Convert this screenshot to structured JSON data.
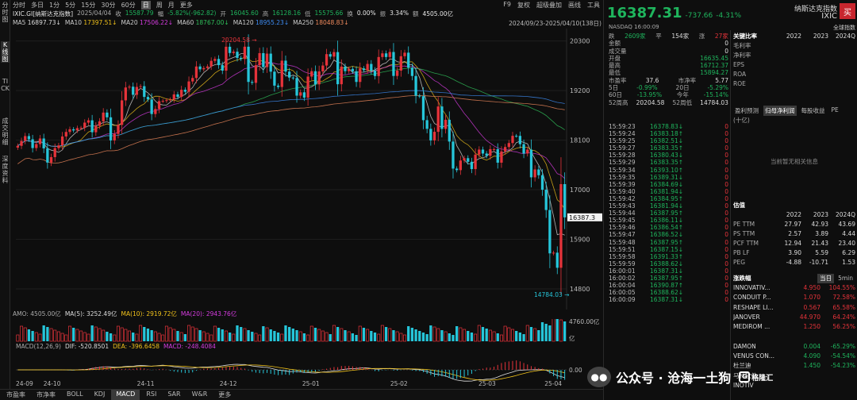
{
  "left_tabs": [
    "分时图",
    "K线图",
    "TICK",
    "成交明细",
    "深度资料"
  ],
  "toolbar": {
    "periods": [
      "分时",
      "多日",
      "1分",
      "5分",
      "15分",
      "30分",
      "60分",
      "日",
      "周",
      "月",
      "更多"
    ],
    "active": "日",
    "right": [
      "F9",
      "复权",
      "超级叠加",
      "画线",
      "工具"
    ]
  },
  "quote_line": {
    "code": "IXIC.GI[纳斯达克指数]",
    "date": "2025/04/04",
    "close_label": "收",
    "close": "15587.79",
    "change_label": "幅",
    "change": "-5.82%(-962.82)",
    "open_label": "开",
    "open": "16045.60",
    "high_label": "高",
    "high": "16128.16",
    "low_label": "低",
    "low": "15575.66",
    "turnover_label": "换",
    "turnover": "0.00%",
    "amp_label": "振",
    "amp": "3.34%",
    "amt_label": "额",
    "amt": "4505.00亿"
  },
  "ma_legend": [
    {
      "label": "MA5",
      "value": "16897.73↓",
      "color": "#dddddd"
    },
    {
      "label": "MA10",
      "value": "17397.51↓",
      "color": "#f1c21b"
    },
    {
      "label": "MA20",
      "value": "17506.22↓",
      "color": "#d63be0"
    },
    {
      "label": "MA60",
      "value": "18767.00↓",
      "color": "#2fbf5a"
    },
    {
      "label": "MA120",
      "value": "18955.23↓",
      "color": "#3e8ef7"
    },
    {
      "label": "MA250",
      "value": "18048.83↓",
      "color": "#f08a5d"
    }
  ],
  "range": "2024/09/23-2025/04/10(138日)",
  "chart_data": {
    "type": "candlestick",
    "ylim": [
      14500,
      20400
    ],
    "y_ticks": [
      "20300",
      "19200",
      "18100",
      "17000",
      "15900",
      "14800"
    ],
    "x_ticks": [
      "24-09",
      "24-10",
      "24-11",
      "24-12",
      "25-01",
      "25-02",
      "25-03",
      "25-04"
    ],
    "max_label": "20204.58",
    "min_label": "14784.03",
    "last_label": "16387.3",
    "close": [
      17974,
      18082,
      18190,
      18119,
      17925,
      18013,
      18137,
      17918,
      17602,
      17724,
      17923,
      17983,
      18182,
      18282,
      18342,
      18315,
      18367,
      18374,
      18489,
      18540,
      18276,
      18417,
      18518,
      18712,
      18607,
      18095,
      18239,
      18439,
      18983,
      19269,
      19286,
      19107,
      19281,
      19298,
      19060,
      19004,
      18680,
      18791,
      18966,
      18972,
      18987,
      19003,
      19116,
      19060,
      19218,
      19174,
      19403,
      19480,
      19735,
      19672,
      19700,
      19736,
      19860,
      19902,
      19765,
      19643,
      20173,
      20034,
      20062,
      19926,
      19902,
      20174,
      19392,
      19372,
      19764,
      20031,
      19722,
      20020,
      19620,
      19310,
      19280,
      19864,
      19621,
      19489,
      19478,
      19088,
      19162,
      19044,
      19511,
      19630,
      19338,
      19626,
      19756,
      20009,
      19954,
      20054,
      19341,
      19733,
      19632,
      19681,
      19628,
      19392,
      19692,
      19654,
      19791,
      19643,
      19523,
      19945,
      20026,
      19945,
      20056,
      19525,
      19644,
      19963,
      20041,
      19709,
      19524,
      19087,
      19076,
      18544,
      18351,
      18095,
      18285,
      18847,
      18350,
      18552,
      18069,
      17469,
      17435,
      17649,
      17700,
      17620,
      17458,
      17780,
      17891,
      17803,
      17752,
      17900,
      17900,
      17600,
      17850,
      17948,
      18036,
      18196,
      18195,
      18011,
      17804,
      17890,
      17275,
      17450,
      17322,
      17000,
      16550,
      15587.79,
      15603,
      15268,
      17124,
      16387.31
    ],
    "annotations": [
      {
        "text": "20204.58",
        "x_index": 62
      },
      {
        "text": "14784.03",
        "x_index": 146
      }
    ]
  },
  "amo_legend": [
    {
      "label": "AMO: 4505.00亿",
      "color": "#aaaaaa"
    },
    {
      "label": "MA(5): 3252.49亿",
      "color": "#dddddd"
    },
    {
      "label": "MA(10): 2919.72亿",
      "color": "#f1c21b"
    },
    {
      "label": "MA(20): 2943.76亿",
      "color": "#d63be0"
    }
  ],
  "amo_axis": [
    "4760.00亿",
    "亿"
  ],
  "macd_legend": [
    {
      "label": "MACD(12,26,9)",
      "color": "#aaaaaa"
    },
    {
      "label": "DIF: -520.8501",
      "color": "#dddddd"
    },
    {
      "label": "DEA: -396.6458",
      "color": "#f1c21b"
    },
    {
      "label": "MACD: -248.4084",
      "color": "#d63be0"
    }
  ],
  "macd_axis": [
    "0.00"
  ],
  "bottom_tabs": [
    "市盈率",
    "市净率",
    "BOLL",
    "KDJ",
    "MACD",
    "RSI",
    "SAR",
    "W&R",
    "更多"
  ],
  "bottom_active": "MACD",
  "header": {
    "price": "16387.31",
    "change": "-737.66",
    "change_pct": "-4.31%",
    "name": "纳斯达克指数",
    "code": "IXIC",
    "buy": "买",
    "exchange": "NASDAQ",
    "time": "16:00:09",
    "settle": "全球指数"
  },
  "breadth": {
    "down_label": "跌",
    "down": "2609家",
    "flat_label": "平",
    "flat": "154家",
    "up_label": "涨",
    "up": "27家"
  },
  "stats": [
    {
      "k": "金额",
      "v": "0",
      "c": "#dddddd"
    },
    {
      "k": "成交量",
      "v": "0",
      "c": "#dddddd"
    },
    {
      "k": "开盘",
      "v": "16635.45",
      "c": "#1fb55d"
    },
    {
      "k": "最高",
      "v": "16712.37",
      "c": "#1fb55d"
    },
    {
      "k": "最低",
      "v": "15894.27",
      "c": "#1fb55d"
    }
  ],
  "stats2": [
    [
      "市盈率",
      "37.6",
      "市净率",
      "5.77"
    ],
    [
      "5日",
      "-0.99%",
      "20日",
      "-5.29%"
    ],
    [
      "60日",
      "-13.95%",
      "今年",
      "-15.14%"
    ],
    [
      "52周高",
      "20204.58",
      "52周低",
      "14784.03"
    ]
  ],
  "ticks": [
    [
      "15:59:23",
      "16378.83↓",
      "0"
    ],
    [
      "15:59:24",
      "16383.18↑",
      "0"
    ],
    [
      "15:59:25",
      "16382.51↓",
      "0"
    ],
    [
      "15:59:27",
      "16383.35↑",
      "0"
    ],
    [
      "15:59:28",
      "16380.43↓",
      "0"
    ],
    [
      "15:59:29",
      "16383.35↑",
      "0"
    ],
    [
      "15:59:34",
      "16393.10↑",
      "0"
    ],
    [
      "15:59:35",
      "16389.31↓",
      "0"
    ],
    [
      "15:59:39",
      "16384.69↓",
      "0"
    ],
    [
      "15:59:40",
      "16381.94↓",
      "0"
    ],
    [
      "15:59:42",
      "16384.95↑",
      "0"
    ],
    [
      "15:59:43",
      "16381.94↓",
      "0"
    ],
    [
      "15:59:44",
      "16387.95↑",
      "0"
    ],
    [
      "15:59:45",
      "16386.11↓",
      "0"
    ],
    [
      "15:59:46",
      "16386.54↑",
      "0"
    ],
    [
      "15:59:47",
      "16386.52↓",
      "0"
    ],
    [
      "15:59:48",
      "16387.95↑",
      "0"
    ],
    [
      "15:59:51",
      "16387.15↓",
      "0"
    ],
    [
      "15:59:58",
      "16391.33↑",
      "0"
    ],
    [
      "15:59:59",
      "16388.62↓",
      "0"
    ],
    [
      "16:00:01",
      "16387.31↓",
      "0"
    ],
    [
      "16:00:02",
      "16387.95↑",
      "0"
    ],
    [
      "16:00:04",
      "16390.87↑",
      "0"
    ],
    [
      "16:00:05",
      "16388.62↓",
      "0"
    ],
    [
      "16:00:09",
      "16387.31↓",
      "0"
    ]
  ],
  "fin": {
    "title": "关键比率",
    "years": [
      "2022",
      "2023",
      "2024Q"
    ],
    "rows": [
      [
        "毛利率",
        "",
        "",
        ""
      ],
      [
        "净利率",
        "",
        "",
        ""
      ],
      [
        "EPS",
        "",
        "",
        ""
      ],
      [
        "ROA",
        "",
        "",
        ""
      ],
      [
        "ROE",
        "",
        "",
        ""
      ]
    ]
  },
  "profit_tabs": [
    "盈利预测",
    "归母净利润",
    "每股收益",
    "PE"
  ],
  "profit_note": "(十亿)",
  "no_data": "当前暂无相关信息",
  "valuation": {
    "title": "估值",
    "years": [
      "2022",
      "2023",
      "2024Q"
    ],
    "rows": [
      [
        "PE TTM",
        "27.97",
        "42.93",
        "43.69"
      ],
      [
        "PS TTM",
        "2.57",
        "3.89",
        "4.44"
      ],
      [
        "PCF TTM",
        "12.94",
        "21.43",
        "23.40"
      ],
      [
        "PB LF",
        "3.90",
        "5.59",
        "6.29"
      ],
      [
        "PEG",
        "-4.88",
        "-10.71",
        "1.53"
      ]
    ]
  },
  "gainers": {
    "title": "涨跌幅",
    "tabs": [
      "当日",
      "5min"
    ],
    "rows": [
      [
        "INNOVATIV...",
        "4.950",
        "104.55%",
        "#e5333a"
      ],
      [
        "CONDUIT P...",
        "1.070",
        "72.58%",
        "#e5333a"
      ],
      [
        "RESHAPE LI...",
        "0.567",
        "65.58%",
        "#e5333a"
      ],
      [
        "JANOVER",
        "44.970",
        "64.24%",
        "#e5333a"
      ],
      [
        "MEDIROM ...",
        "1.250",
        "56.25%",
        "#e5333a"
      ],
      [
        "",
        "",
        "",
        ""
      ],
      [
        "DAMON",
        "0.004",
        "-65.29%",
        "#1fb55d"
      ],
      [
        "VENUS CON...",
        "4.090",
        "-54.54%",
        "#1fb55d"
      ],
      [
        "杜兰迪",
        "1.450",
        "-54.23%",
        "#1fb55d"
      ],
      [
        "马林软件",
        "",
        "",
        ""
      ],
      [
        "INOTIV",
        "",
        "",
        ""
      ]
    ]
  },
  "watermark": {
    "text": "公众号 · 沧海一土狗",
    "logo": "格隆汇"
  }
}
